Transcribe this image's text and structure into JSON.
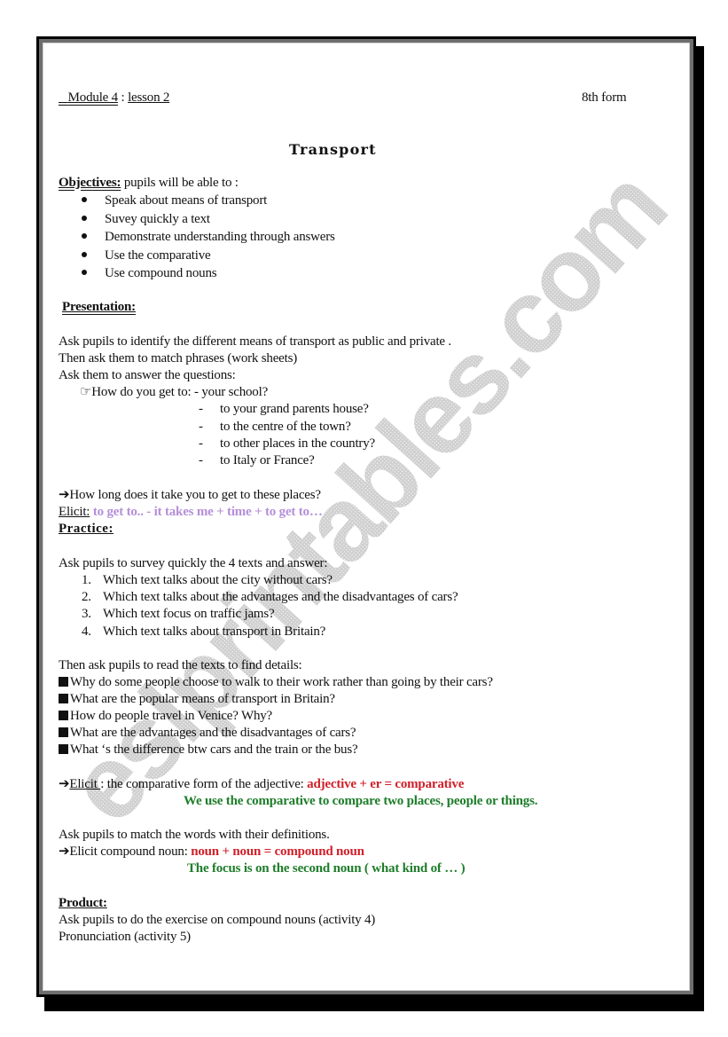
{
  "header": {
    "module_label": "Module 4",
    "separator": " : ",
    "lesson_label": "lesson 2",
    "form_label": "8th form"
  },
  "title": "Transport",
  "objectives": {
    "heading": "Objectives:",
    "intro": " pupils will be able to :",
    "items": [
      "Speak about means of transport",
      "Suvey quickly a text",
      "Demonstrate understanding through answers",
      "Use the comparative",
      "Use compound nouns"
    ]
  },
  "presentation": {
    "heading": "Presentation:",
    "lines": [
      "Ask pupils to identify the different means of transport as public and private .",
      "Then ask them to match phrases (work sheets)",
      "Ask them to answer the questions:"
    ],
    "question_icon": "☞",
    "question_lead": "How do you get to: - your school?",
    "destinations": [
      "to your grand parents house?",
      "to the centre of the town?",
      "to other places in the country?",
      "to Italy or France?"
    ],
    "arrow_icon": "➔",
    "how_long": "How long does it take you to get to these places?",
    "elicit_label": "Elicit:",
    "elicit_text": " to get to..  -   it takes me + time + to get to…"
  },
  "practice": {
    "heading": "Practice:",
    "survey_intro": "Ask pupils to survey quickly the 4 texts and answer:",
    "survey_questions": [
      "Which text talks about the city without cars?",
      "Which text talks about the advantages and the disadvantages of cars?",
      "Which text focus on traffic jams?",
      "Which text talks about transport in Britain?"
    ],
    "details_intro": "Then ask pupils to read the texts to find details:",
    "detail_questions": [
      "Why do some people choose to walk to their work rather than going by their cars?",
      "What are the popular means of transport in Britain?",
      "How do people travel in Venice? Why?",
      "What are the advantages and the disadvantages of cars?",
      "What ‘s the difference btw cars and the train or the bus?"
    ],
    "elicit_comparative_label": "Elicit ",
    "elicit_comparative_text": ": the comparative form of the adjective: ",
    "comparative_rule": "adjective + er = comparative",
    "comparative_note": "We use the comparative to compare two places, people or things.",
    "match_words": "Ask pupils to match the words with their definitions.",
    "elicit_compound_text": "Elicit compound noun: ",
    "compound_rule": "noun + noun = compound noun",
    "compound_note": "The focus is on the second noun ( what kind of … )"
  },
  "product": {
    "heading": "Product:",
    "lines": [
      "Ask pupils to do the exercise on compound nouns (activity 4)",
      "Pronunciation (activity 5)"
    ]
  },
  "watermark": "eslprintables.com",
  "colors": {
    "elicit_purple": "#b48fd8",
    "rule_red": "#d0202a",
    "note_green": "#1e7d2a"
  }
}
